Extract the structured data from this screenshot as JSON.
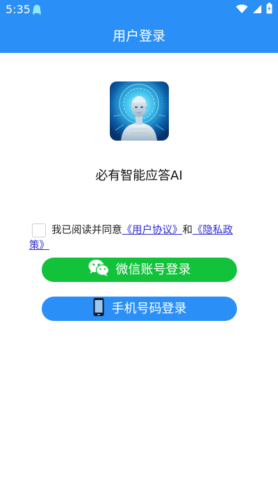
{
  "status_bar": {
    "time": "5:35",
    "color": "#2a8ff7",
    "icons": [
      "notification-icon",
      "wifi-icon",
      "signal-icon",
      "battery-icon"
    ]
  },
  "app_bar": {
    "title": "用户登录",
    "color": "#2a8ff7"
  },
  "logo": {
    "icon": "robot-logo"
  },
  "app_name": "必有智能应答AI",
  "agreement": {
    "checked": false,
    "prefix": "我已阅读并同意",
    "user_agreement": "《用户协议》",
    "conjunction": "和",
    "privacy_policy": "《隐私政策》"
  },
  "buttons": {
    "wechat_login": {
      "label": "微信账号登录",
      "color": "#11c23a",
      "icon": "wechat-icon"
    },
    "phone_login": {
      "label": "手机号码登录",
      "color": "#2a8ff7",
      "icon": "phone-icon"
    }
  }
}
